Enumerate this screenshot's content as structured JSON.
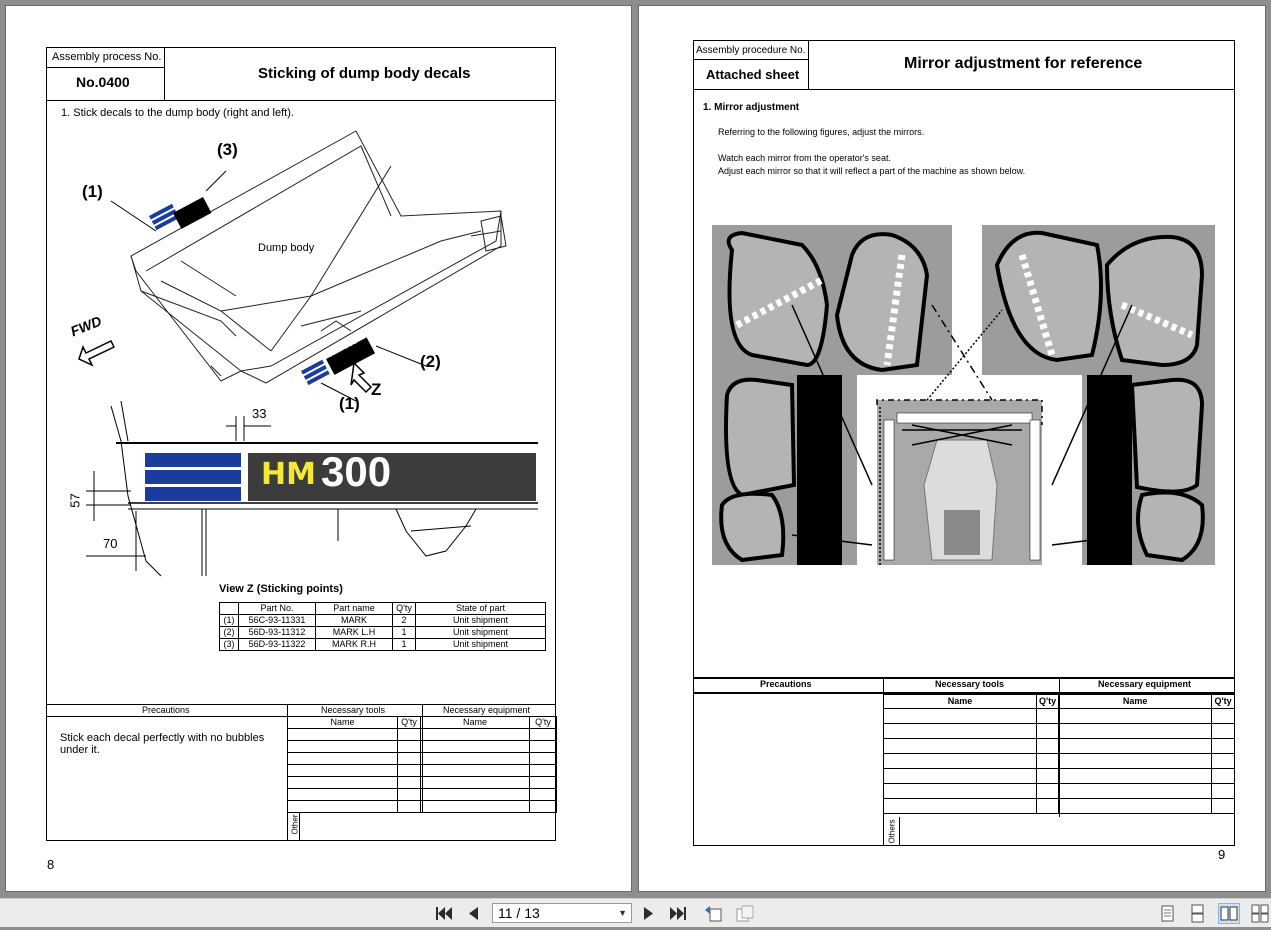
{
  "left_page": {
    "assembly_label": "Assembly process No.",
    "process_no": "No.0400",
    "title": "Sticking of dump body decals",
    "step1": "1. Stick decals to the dump body (right and left).",
    "callout_1": "(1)",
    "callout_1b": "(1)",
    "callout_2": "(2)",
    "callout_3": "(3)",
    "dump_body": "Dump body",
    "fwd": "FWD",
    "z": "Z",
    "decal_text_hm": "HM",
    "decal_text_300": "300",
    "decal_small": "HM 300",
    "dim_33": "33",
    "dim_57": "57",
    "dim_70": "70",
    "view_z": "View Z (Sticking points)",
    "parts_headers": [
      "Part No.",
      "Part name",
      "Q'ty",
      "State of part"
    ],
    "parts": [
      {
        "idx": "(1)",
        "part_no": "56C-93-11331",
        "name": "MARK",
        "qty": "2",
        "state": "Unit shipment"
      },
      {
        "idx": "(2)",
        "part_no": "56D-93-11312",
        "name": "MARK L.H",
        "qty": "1",
        "state": "Unit shipment"
      },
      {
        "idx": "(3)",
        "part_no": "56D-93-11322",
        "name": "MARK R.H",
        "qty": "1",
        "state": "Unit shipment"
      }
    ],
    "precautions_label": "Precautions",
    "tools_label": "Necessary tools",
    "equipment_label": "Necessary equipment",
    "name_label": "Name",
    "qty_label": "Q'ty",
    "precaution_text": "Stick each decal perfectly with no bubbles under it.",
    "other_label": "Other",
    "page_number": "8"
  },
  "right_page": {
    "assembly_label": "Assembly procedure No.",
    "attached": "Attached sheet",
    "title": "Mirror adjustment for reference",
    "section": "1.  Mirror adjustment",
    "line1": "Referring to the following figures, adjust the mirrors.",
    "line2": "Watch each mirror from the operator's seat.",
    "line3": "Adjust each mirror so that it will reflect a part of the machine as shown below.",
    "precautions_label": "Precautions",
    "tools_label": "Necessary tools",
    "equipment_label": "Necessary equipment",
    "name_label": "Name",
    "qty_label": "Q'ty",
    "others_label": "Others",
    "page_number": "9"
  },
  "toolbar": {
    "page_indicator": "11 / 13",
    "icons": [
      "first-page-icon",
      "prev-page-icon",
      "next-page-icon",
      "last-page-icon",
      "go-back-icon",
      "go-forward-icon",
      "single-page-view-icon",
      "continuous-view-icon",
      "two-page-view-icon",
      "two-page-continuous-view-icon"
    ]
  }
}
